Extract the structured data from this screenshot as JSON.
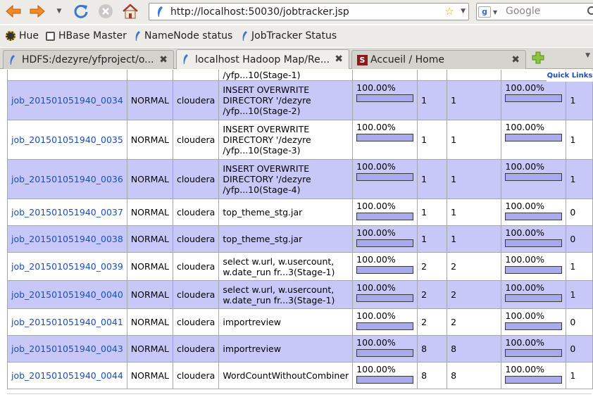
{
  "browser": {
    "url": "http://localhost:50030/jobtracker.jsp",
    "search_placeholder": "Google",
    "bookmarks": [
      {
        "label": "Hue",
        "icon": "hue-icon"
      },
      {
        "label": "HBase Master",
        "icon": "hbase-icon"
      },
      {
        "label": "NameNode status",
        "icon": "hadoop-feather-icon"
      },
      {
        "label": "JobTracker Status",
        "icon": "hadoop-feather-icon"
      }
    ],
    "tabs": [
      {
        "label": "HDFS:/dezyre/yfproject/o...",
        "icon": "hadoop-feather-icon",
        "active": false
      },
      {
        "label": "localhost Hadoop Map/Re...",
        "icon": "hadoop-feather-icon",
        "active": true
      },
      {
        "label": "Accueil / Home",
        "icon": "s-logo-icon",
        "active": false
      }
    ]
  },
  "page": {
    "quick_links": "Quick Links",
    "partial_row": {
      "name_tail": "/yfp...10(Stage-1)"
    },
    "jobs": [
      {
        "id": "job_201501051940_0034",
        "priority": "NORMAL",
        "user": "cloudera",
        "name": [
          "INSERT OVERWRITE",
          "DIRECTORY '/dezyre",
          "/yfp...10(Stage-2)"
        ],
        "map_pct": "100.00%",
        "map_total": "1",
        "map_completed": "1",
        "reduce_pct": "100.00%",
        "reduce_total": "1",
        "map_fill": 1.0,
        "reduce_fill": 1.0
      },
      {
        "id": "job_201501051940_0035",
        "priority": "NORMAL",
        "user": "cloudera",
        "name": [
          "INSERT OVERWRITE",
          "DIRECTORY '/dezyre",
          "/yfp...10(Stage-3)"
        ],
        "map_pct": "100.00%",
        "map_total": "1",
        "map_completed": "1",
        "reduce_pct": "100.00%",
        "reduce_total": "1",
        "map_fill": 1.0,
        "reduce_fill": 1.0
      },
      {
        "id": "job_201501051940_0036",
        "priority": "NORMAL",
        "user": "cloudera",
        "name": [
          "INSERT OVERWRITE",
          "DIRECTORY '/dezyre",
          "/yfp...10(Stage-4)"
        ],
        "map_pct": "100.00%",
        "map_total": "1",
        "map_completed": "1",
        "reduce_pct": "100.00%",
        "reduce_total": "1",
        "map_fill": 1.0,
        "reduce_fill": 1.0
      },
      {
        "id": "job_201501051940_0037",
        "priority": "NORMAL",
        "user": "cloudera",
        "name": [
          "top_theme_stg.jar"
        ],
        "map_pct": "100.00%",
        "map_total": "1",
        "map_completed": "1",
        "reduce_pct": "100.00%",
        "reduce_total": "0",
        "map_fill": 1.0,
        "reduce_fill": 1.0
      },
      {
        "id": "job_201501051940_0038",
        "priority": "NORMAL",
        "user": "cloudera",
        "name": [
          "top_theme_stg.jar"
        ],
        "map_pct": "100.00%",
        "map_total": "1",
        "map_completed": "1",
        "reduce_pct": "100.00%",
        "reduce_total": "0",
        "map_fill": 1.0,
        "reduce_fill": 1.0
      },
      {
        "id": "job_201501051940_0039",
        "priority": "NORMAL",
        "user": "cloudera",
        "name": [
          "select w.url, w.usercount,",
          "w.date_run fr...3(Stage-1)"
        ],
        "map_pct": "100.00%",
        "map_total": "2",
        "map_completed": "2",
        "reduce_pct": "100.00%",
        "reduce_total": "1",
        "map_fill": 1.0,
        "reduce_fill": 1.0
      },
      {
        "id": "job_201501051940_0040",
        "priority": "NORMAL",
        "user": "cloudera",
        "name": [
          "select w.url, w.usercount,",
          "w.date_run fr...3(Stage-1)"
        ],
        "map_pct": "100.00%",
        "map_total": "2",
        "map_completed": "2",
        "reduce_pct": "100.00%",
        "reduce_total": "1",
        "map_fill": 1.0,
        "reduce_fill": 1.0
      },
      {
        "id": "job_201501051940_0041",
        "priority": "NORMAL",
        "user": "cloudera",
        "name": [
          "importreview"
        ],
        "map_pct": "100.00%",
        "map_total": "2",
        "map_completed": "2",
        "reduce_pct": "100.00%",
        "reduce_total": "0",
        "map_fill": 1.0,
        "reduce_fill": 1.0
      },
      {
        "id": "job_201501051940_0043",
        "priority": "NORMAL",
        "user": "cloudera",
        "name": [
          "importreview"
        ],
        "map_pct": "100.00%",
        "map_total": "8",
        "map_completed": "8",
        "reduce_pct": "100.00%",
        "reduce_total": "0",
        "map_fill": 1.0,
        "reduce_fill": 1.0
      },
      {
        "id": "job_201501051940_0044",
        "priority": "NORMAL",
        "user": "cloudera",
        "name": [
          "WordCountWithoutCombiner"
        ],
        "map_pct": "100.00%",
        "map_total": "8",
        "map_completed": "8",
        "reduce_pct": "100.00%",
        "reduce_total": "1",
        "map_fill": 1.0,
        "reduce_fill": 1.0
      }
    ]
  }
}
